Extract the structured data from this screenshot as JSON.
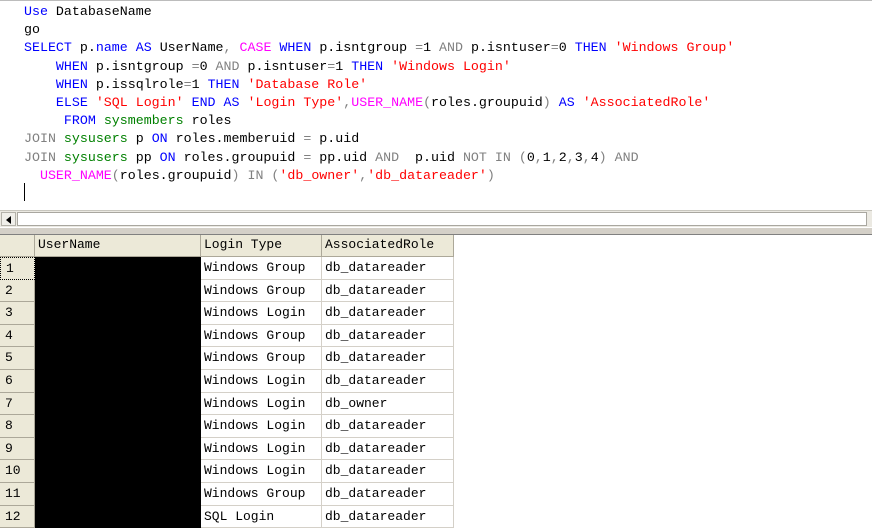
{
  "editor": {
    "code_lines": [
      [
        {
          "t": "Use",
          "c": "kw"
        },
        {
          "t": " DatabaseName",
          "c": "txt"
        }
      ],
      [
        {
          "t": "go",
          "c": "txt"
        }
      ],
      [
        {
          "t": "SELECT",
          "c": "kw"
        },
        {
          "t": " p.",
          "c": "txt"
        },
        {
          "t": "name",
          "c": "kw"
        },
        {
          "t": " ",
          "c": "txt"
        },
        {
          "t": "AS",
          "c": "kw"
        },
        {
          "t": " UserName",
          "c": "txt"
        },
        {
          "t": ",",
          "c": "op"
        },
        {
          "t": " ",
          "c": "txt"
        },
        {
          "t": "CASE",
          "c": "fn"
        },
        {
          "t": " ",
          "c": "txt"
        },
        {
          "t": "WHEN",
          "c": "kw"
        },
        {
          "t": " p.isntgroup ",
          "c": "txt"
        },
        {
          "t": "=",
          "c": "op"
        },
        {
          "t": "1 ",
          "c": "txt"
        },
        {
          "t": "AND",
          "c": "op"
        },
        {
          "t": " p.isntuser",
          "c": "txt"
        },
        {
          "t": "=",
          "c": "op"
        },
        {
          "t": "0 ",
          "c": "txt"
        },
        {
          "t": "THEN",
          "c": "kw"
        },
        {
          "t": " ",
          "c": "txt"
        },
        {
          "t": "'Windows Group'",
          "c": "str"
        }
      ],
      [
        {
          "t": "    ",
          "c": "txt"
        },
        {
          "t": "WHEN",
          "c": "kw"
        },
        {
          "t": " p.isntgroup ",
          "c": "txt"
        },
        {
          "t": "=",
          "c": "op"
        },
        {
          "t": "0 ",
          "c": "txt"
        },
        {
          "t": "AND",
          "c": "op"
        },
        {
          "t": " p.isntuser",
          "c": "txt"
        },
        {
          "t": "=",
          "c": "op"
        },
        {
          "t": "1 ",
          "c": "txt"
        },
        {
          "t": "THEN",
          "c": "kw"
        },
        {
          "t": " ",
          "c": "txt"
        },
        {
          "t": "'Windows Login'",
          "c": "str"
        }
      ],
      [
        {
          "t": "    ",
          "c": "txt"
        },
        {
          "t": "WHEN",
          "c": "kw"
        },
        {
          "t": " p.issqlrole",
          "c": "txt"
        },
        {
          "t": "=",
          "c": "op"
        },
        {
          "t": "1 ",
          "c": "txt"
        },
        {
          "t": "THEN",
          "c": "kw"
        },
        {
          "t": " ",
          "c": "txt"
        },
        {
          "t": "'Database Role'",
          "c": "str"
        }
      ],
      [
        {
          "t": "    ",
          "c": "txt"
        },
        {
          "t": "ELSE",
          "c": "kw"
        },
        {
          "t": " ",
          "c": "txt"
        },
        {
          "t": "'SQL Login'",
          "c": "str"
        },
        {
          "t": " ",
          "c": "txt"
        },
        {
          "t": "END",
          "c": "kw"
        },
        {
          "t": " ",
          "c": "txt"
        },
        {
          "t": "AS",
          "c": "kw"
        },
        {
          "t": " ",
          "c": "txt"
        },
        {
          "t": "'Login Type'",
          "c": "str"
        },
        {
          "t": ",",
          "c": "op"
        },
        {
          "t": "USER_NAME",
          "c": "fn"
        },
        {
          "t": "(",
          "c": "op"
        },
        {
          "t": "roles.groupuid",
          "c": "txt"
        },
        {
          "t": ")",
          "c": "op"
        },
        {
          "t": " ",
          "c": "txt"
        },
        {
          "t": "AS",
          "c": "kw"
        },
        {
          "t": " ",
          "c": "txt"
        },
        {
          "t": "'AssociatedRole'",
          "c": "str"
        }
      ],
      [
        {
          "t": "     ",
          "c": "txt"
        },
        {
          "t": "FROM",
          "c": "kw"
        },
        {
          "t": " ",
          "c": "txt"
        },
        {
          "t": "sysmembers",
          "c": "sys"
        },
        {
          "t": " roles",
          "c": "txt"
        }
      ],
      [
        {
          "t": "JOIN",
          "c": "op"
        },
        {
          "t": " ",
          "c": "txt"
        },
        {
          "t": "sysusers",
          "c": "sys"
        },
        {
          "t": " p ",
          "c": "txt"
        },
        {
          "t": "ON",
          "c": "kw"
        },
        {
          "t": " roles.memberuid ",
          "c": "txt"
        },
        {
          "t": "=",
          "c": "op"
        },
        {
          "t": " p.uid",
          "c": "txt"
        }
      ],
      [
        {
          "t": "JOIN",
          "c": "op"
        },
        {
          "t": " ",
          "c": "txt"
        },
        {
          "t": "sysusers",
          "c": "sys"
        },
        {
          "t": " pp ",
          "c": "txt"
        },
        {
          "t": "ON",
          "c": "kw"
        },
        {
          "t": " roles.groupuid ",
          "c": "txt"
        },
        {
          "t": "=",
          "c": "op"
        },
        {
          "t": " pp.uid ",
          "c": "txt"
        },
        {
          "t": "AND",
          "c": "op"
        },
        {
          "t": "  p.uid ",
          "c": "txt"
        },
        {
          "t": "NOT",
          "c": "op"
        },
        {
          "t": " ",
          "c": "txt"
        },
        {
          "t": "IN",
          "c": "op"
        },
        {
          "t": " ",
          "c": "txt"
        },
        {
          "t": "(",
          "c": "op"
        },
        {
          "t": "0",
          "c": "txt"
        },
        {
          "t": ",",
          "c": "op"
        },
        {
          "t": "1",
          "c": "txt"
        },
        {
          "t": ",",
          "c": "op"
        },
        {
          "t": "2",
          "c": "txt"
        },
        {
          "t": ",",
          "c": "op"
        },
        {
          "t": "3",
          "c": "txt"
        },
        {
          "t": ",",
          "c": "op"
        },
        {
          "t": "4",
          "c": "txt"
        },
        {
          "t": ")",
          "c": "op"
        },
        {
          "t": " ",
          "c": "txt"
        },
        {
          "t": "AND",
          "c": "op"
        }
      ],
      [
        {
          "t": "  ",
          "c": "txt"
        },
        {
          "t": "USER_NAME",
          "c": "fn"
        },
        {
          "t": "(",
          "c": "op"
        },
        {
          "t": "roles.groupuid",
          "c": "txt"
        },
        {
          "t": ")",
          "c": "op"
        },
        {
          "t": " ",
          "c": "txt"
        },
        {
          "t": "IN",
          "c": "op"
        },
        {
          "t": " ",
          "c": "txt"
        },
        {
          "t": "(",
          "c": "op"
        },
        {
          "t": "'db_owner'",
          "c": "str"
        },
        {
          "t": ",",
          "c": "op"
        },
        {
          "t": "'db_datareader'",
          "c": "str"
        },
        {
          "t": ")",
          "c": "op"
        }
      ]
    ],
    "colors": {
      "keyword": "#0000ff",
      "function": "#ff00ff",
      "string": "#ff0000",
      "operator": "#808080",
      "system_table": "#008000"
    }
  },
  "grid": {
    "columns": [
      "UserName",
      "Login Type",
      "AssociatedRole"
    ],
    "rows": [
      {
        "num": "1",
        "login_type": "Windows Group",
        "role": "db_datareader"
      },
      {
        "num": "2",
        "login_type": "Windows Group",
        "role": "db_datareader"
      },
      {
        "num": "3",
        "login_type": "Windows Login",
        "role": "db_datareader"
      },
      {
        "num": "4",
        "login_type": "Windows Group",
        "role": "db_datareader"
      },
      {
        "num": "5",
        "login_type": "Windows Group",
        "role": "db_datareader"
      },
      {
        "num": "6",
        "login_type": "Windows Login",
        "role": "db_datareader"
      },
      {
        "num": "7",
        "login_type": "Windows Login",
        "role": "db_owner"
      },
      {
        "num": "8",
        "login_type": "Windows Login",
        "role": "db_datareader"
      },
      {
        "num": "9",
        "login_type": "Windows Login",
        "role": "db_datareader"
      },
      {
        "num": "10",
        "login_type": "Windows Login",
        "role": "db_datareader"
      },
      {
        "num": "11",
        "login_type": "Windows Group",
        "role": "db_datareader"
      },
      {
        "num": "12",
        "login_type": "SQL Login",
        "role": "db_datareader"
      }
    ],
    "username_redaction_color": "#000000"
  }
}
